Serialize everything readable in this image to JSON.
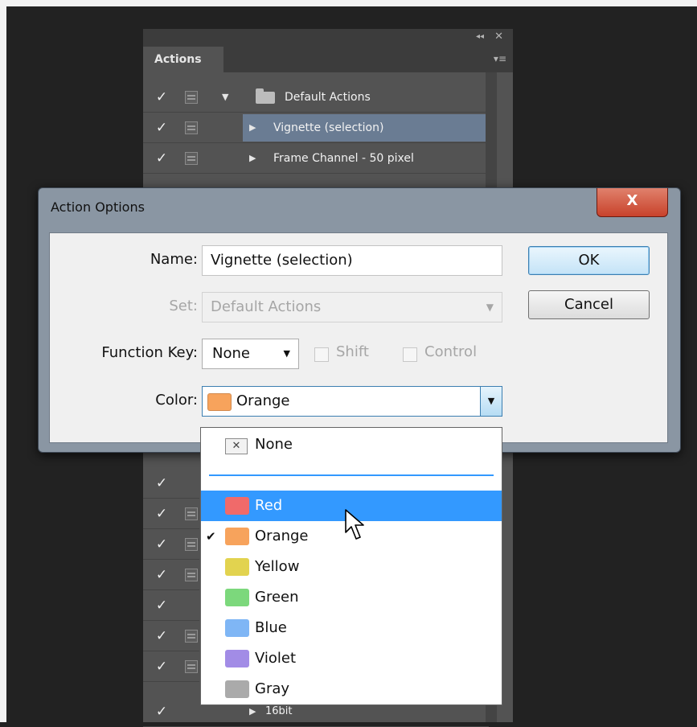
{
  "panel": {
    "tab_label": "Actions",
    "collapse_glyph": "◂◂",
    "close_glyph": "✕",
    "menu_glyph": "▾≡",
    "check_glyph": "✓",
    "rows": [
      {
        "label": "Default Actions",
        "type": "folder",
        "expanded": true
      },
      {
        "label": "Vignette (selection)",
        "type": "action",
        "selected": true
      },
      {
        "label": "Frame Channel - 50 pixel",
        "type": "action"
      }
    ],
    "bottom_row_label": "16bit"
  },
  "dialog": {
    "title": "Action Options",
    "close_label": "X",
    "name_label": "Name:",
    "name_value": "Vignette (selection)",
    "set_label": "Set:",
    "set_value": "Default Actions",
    "function_key_label": "Function Key:",
    "function_key_value": "None",
    "shift_label": "Shift",
    "control_label": "Control",
    "color_label": "Color:",
    "color_value": "Orange",
    "color_value_hex": "#f7a35c",
    "ok_label": "OK",
    "cancel_label": "Cancel"
  },
  "color_dropdown": {
    "none_label": "None",
    "none_icon": "✕",
    "checked_glyph": "✔",
    "items": [
      {
        "label": "Red",
        "color": "#f06a6a",
        "hovered": true
      },
      {
        "label": "Orange",
        "color": "#f7a35c",
        "checked": true
      },
      {
        "label": "Yellow",
        "color": "#e2d34f"
      },
      {
        "label": "Green",
        "color": "#7cd87c"
      },
      {
        "label": "Blue",
        "color": "#7fb6f5"
      },
      {
        "label": "Violet",
        "color": "#a28ce6"
      },
      {
        "label": "Gray",
        "color": "#aaaaaa"
      }
    ]
  }
}
